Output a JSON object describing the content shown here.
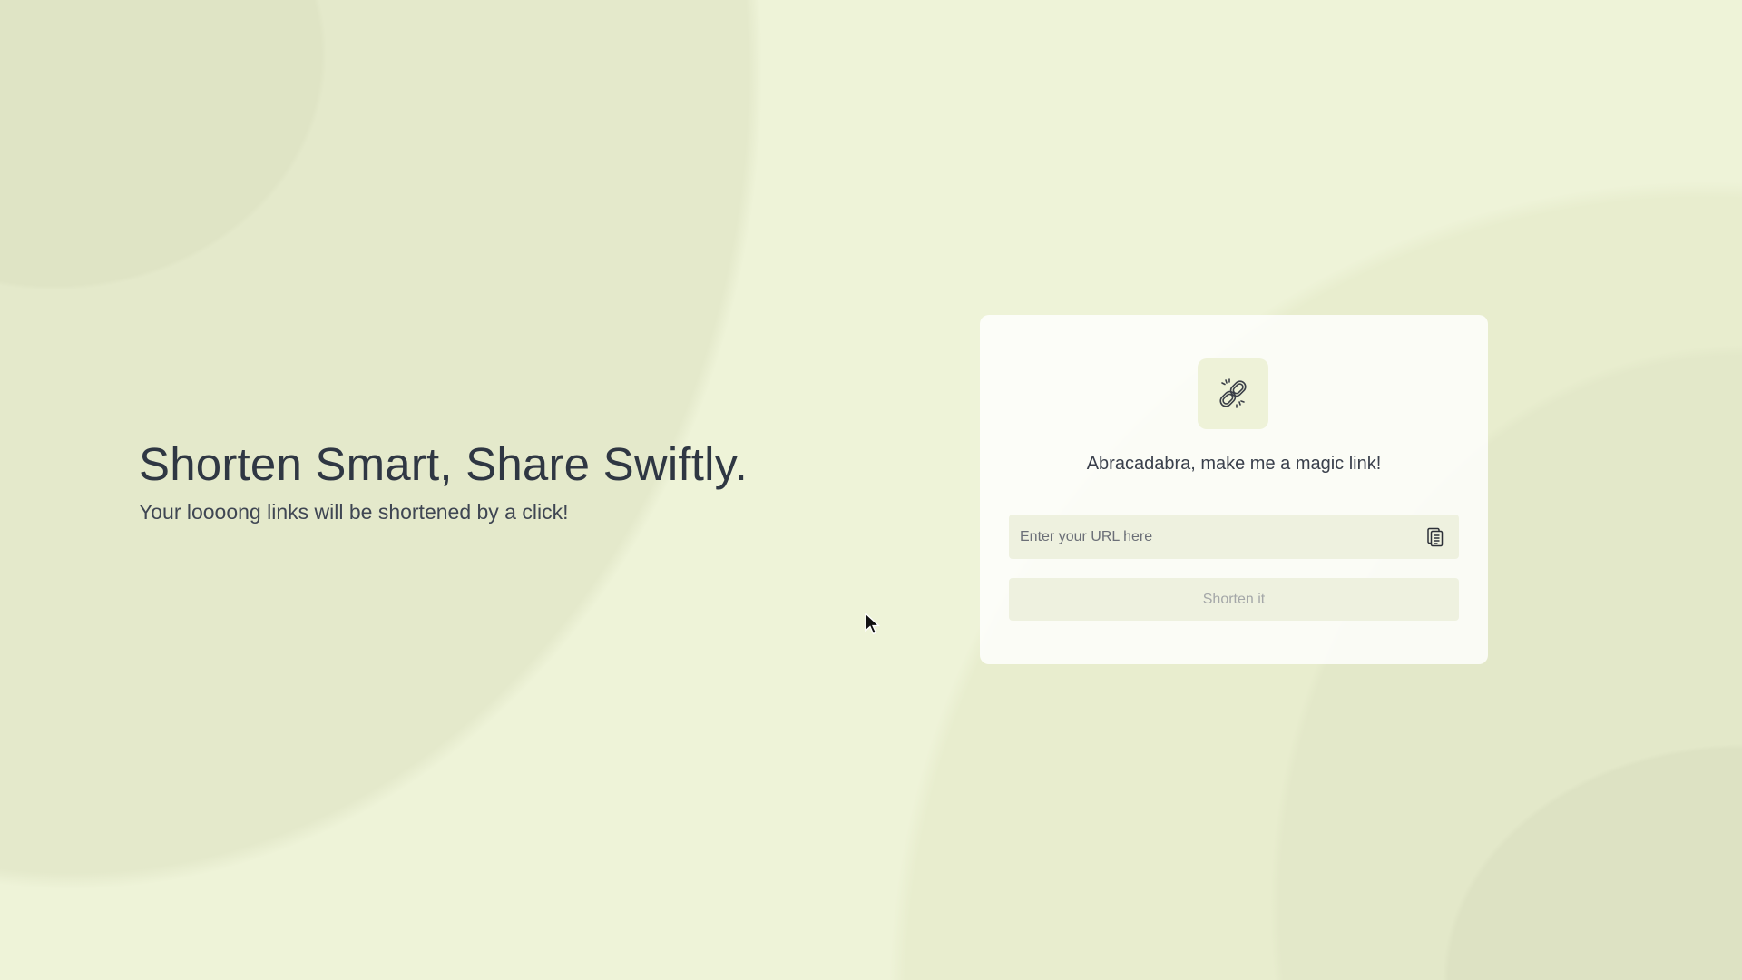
{
  "hero": {
    "heading": "Shorten Smart, Share Swiftly.",
    "subheading": "Your loooong links will be shortened by a click!"
  },
  "card": {
    "icon": "link-icon",
    "title": "Abracadabra, make me a magic link!",
    "url_input": {
      "value": "",
      "placeholder": "Enter your URL here"
    },
    "paste_icon": "clipboard-icon",
    "submit_label": "Shorten it"
  },
  "colors": {
    "background": "#eef3d8",
    "text": "#2f3743",
    "field": "#eef1df"
  }
}
